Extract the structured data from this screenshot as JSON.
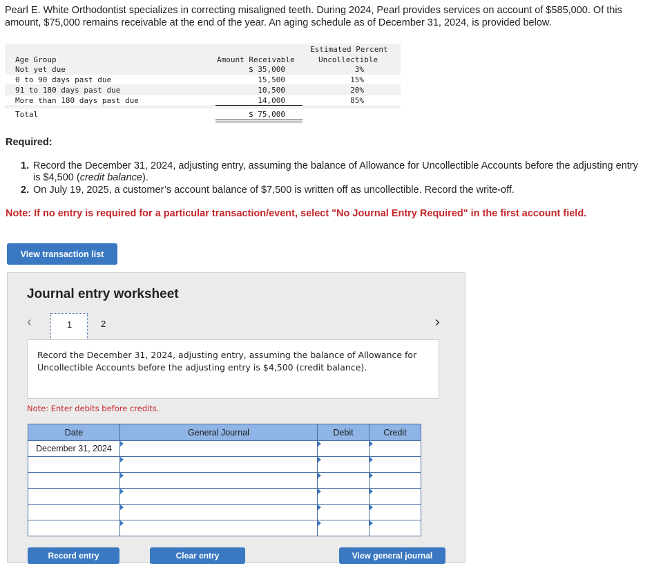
{
  "intro": "Pearl E. White Orthodontist specializes in correcting misaligned teeth. During 2024, Pearl provides services on account of $585,000. Of this amount, $75,000 remains receivable at the end of the year. An aging schedule as of December 31, 2024, is provided below.",
  "aging": {
    "header_age": "Age Group",
    "header_amount": "Amount Receivable",
    "header_pct_line1": "Estimated Percent",
    "header_pct_line2": "Uncollectible",
    "rows": [
      {
        "age": "Not yet due",
        "amount": "$ 35,000",
        "pct": "3%"
      },
      {
        "age": "0 to 90 days past due",
        "amount": "15,500",
        "pct": "15%"
      },
      {
        "age": "91 to 180 days past due",
        "amount": "10,500",
        "pct": "20%"
      },
      {
        "age": "More than 180 days past due",
        "amount": "14,000",
        "pct": "85%"
      }
    ],
    "total_label": "Total",
    "total_amount": "$ 75,000"
  },
  "required_title": "Required:",
  "requirements": [
    {
      "num": "1.",
      "text_a": "Record the December 31, 2024, adjusting entry, assuming the balance of Allowance for Uncollectible Accounts before the adjusting entry is $4,500 (",
      "text_italic": "credit balance",
      "text_b": ")."
    },
    {
      "num": "2.",
      "text_a": "On July 19, 2025, a customer’s account balance of $7,500 is written off as uncollectible. Record the write-off.",
      "text_italic": "",
      "text_b": ""
    }
  ],
  "note": "Note: If no entry is required for a particular transaction/event, select \"No Journal Entry Required\" in the first account field.",
  "view_button": "View transaction list",
  "worksheet": {
    "title": "Journal entry worksheet",
    "pages": [
      "1",
      "2"
    ],
    "description": "Record the December 31, 2024, adjusting entry, assuming the balance of Allowance for Uncollectible Accounts before the adjusting entry is $4,500 (credit balance).",
    "enter_note": "Note: Enter debits before credits.",
    "columns": [
      "Date",
      "General Journal",
      "Debit",
      "Credit"
    ],
    "rows": [
      {
        "date": "December 31, 2024"
      },
      {
        "date": ""
      },
      {
        "date": ""
      },
      {
        "date": ""
      },
      {
        "date": ""
      },
      {
        "date": ""
      }
    ],
    "buttons": [
      "Record entry",
      "Clear entry",
      "View general journal"
    ]
  },
  "colors": {
    "accent": "#3a78c2",
    "note_red": "#c3272b",
    "table_header": "#8fb4e6"
  }
}
